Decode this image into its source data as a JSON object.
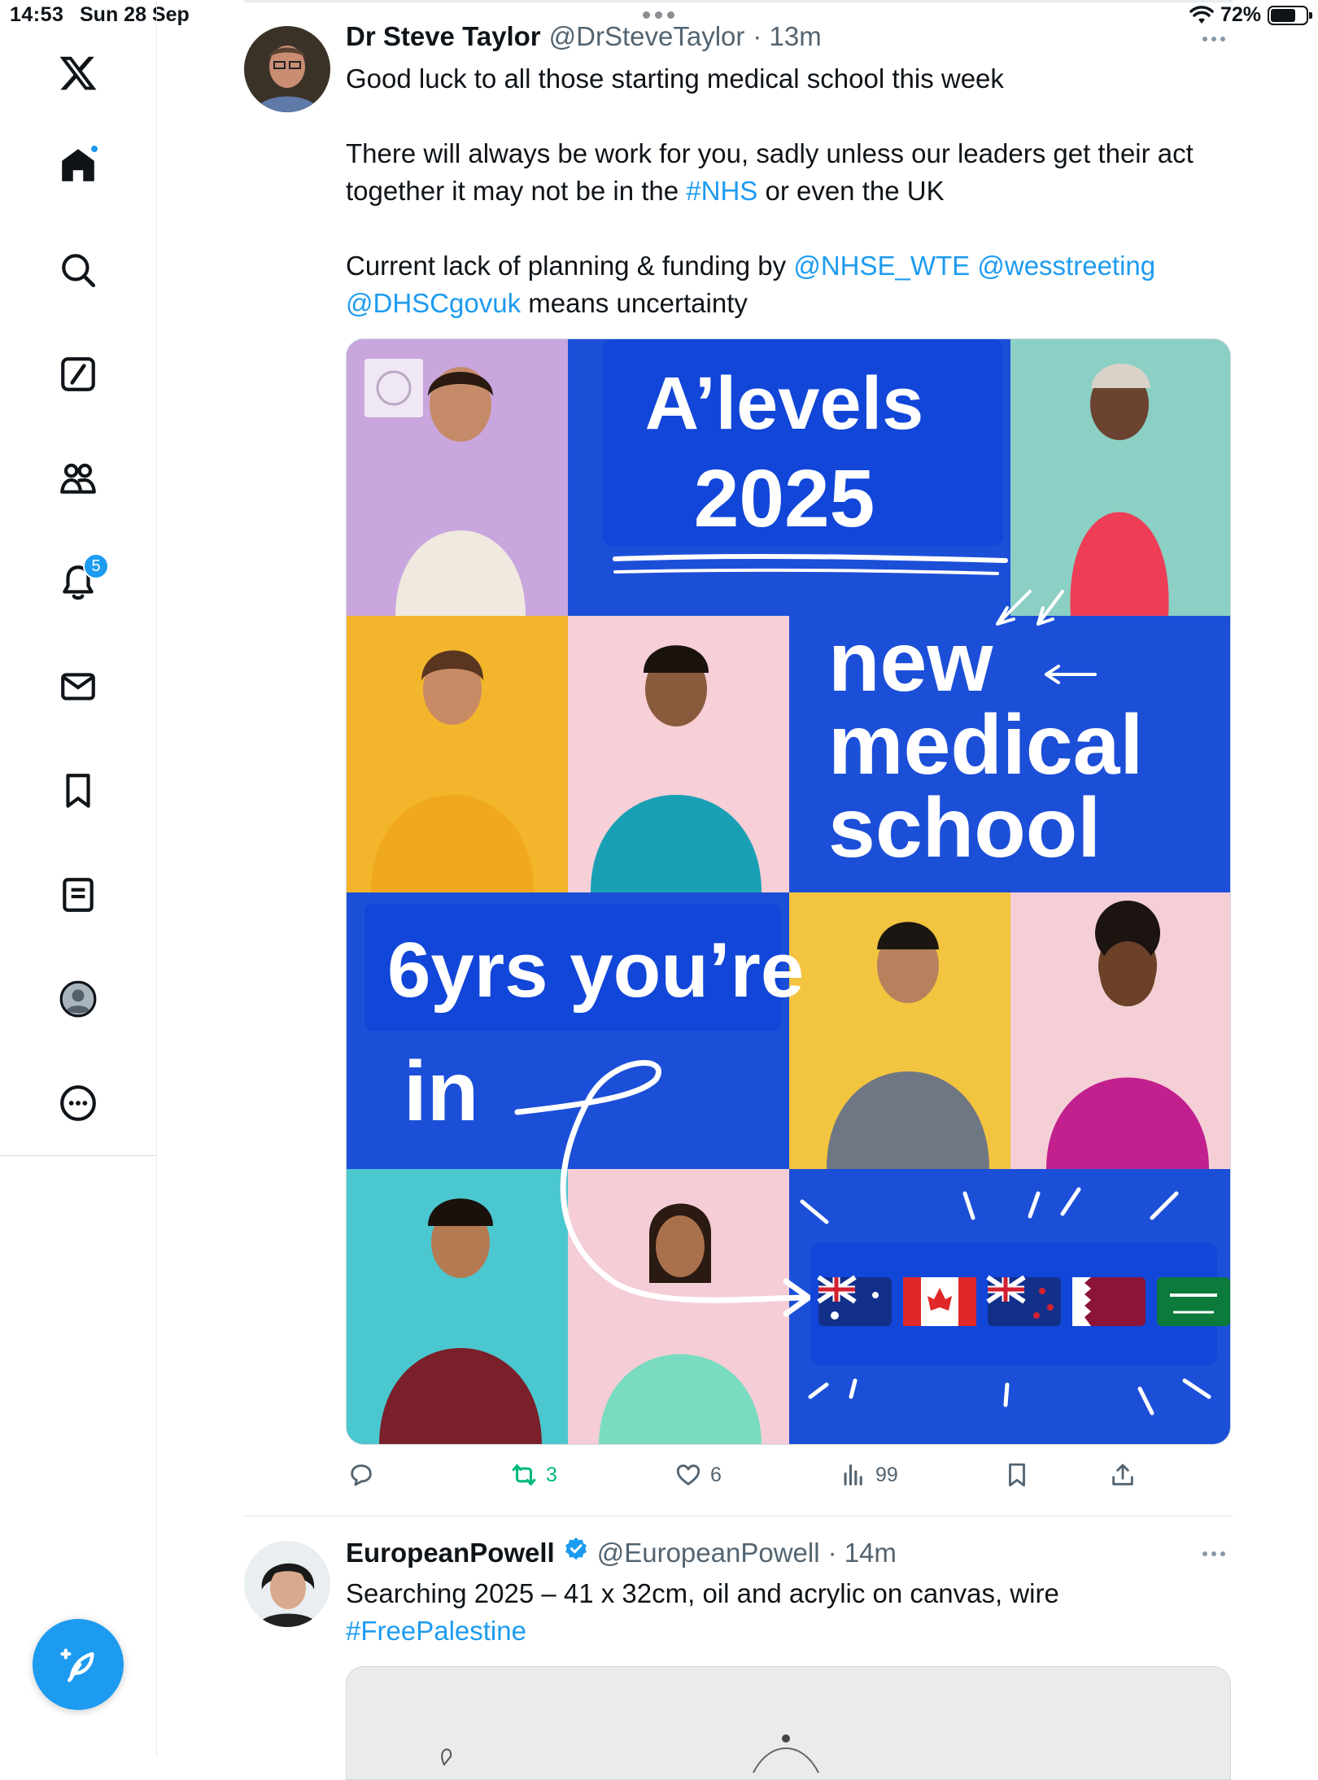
{
  "status_bar": {
    "time": "14:53",
    "date": "Sun 28 Sep",
    "battery": "72%",
    "battery_level": 0.72
  },
  "sidebar": {
    "items": [
      {
        "name": "home",
        "icon": "home-icon"
      },
      {
        "name": "explore",
        "icon": "search-icon"
      },
      {
        "name": "grok",
        "icon": "grok-icon"
      },
      {
        "name": "communities",
        "icon": "communities-icon"
      },
      {
        "name": "notifications",
        "icon": "bell-icon",
        "badge": "5"
      },
      {
        "name": "messages",
        "icon": "mail-icon"
      },
      {
        "name": "bookmarks",
        "icon": "bookmark-icon"
      },
      {
        "name": "lists",
        "icon": "list-icon"
      },
      {
        "name": "profile",
        "icon": "profile-icon"
      },
      {
        "name": "more",
        "icon": "more-circle-icon"
      }
    ]
  },
  "tweet1": {
    "author": "Dr Steve Taylor",
    "handle": "@DrSteveTaylor",
    "time": "· 13m",
    "text": {
      "line1": "Good luck to all those starting medical school this week",
      "p2_a": "There will always be work for you, sadly unless our leaders get their act together it may not be in the ",
      "p2_link": "#NHS",
      "p2_b": " or even the UK",
      "p3_a": "Current lack of planning & funding by ",
      "p3_link1": "@NHSE_WTE",
      "p3_link2": "@wesstreeting",
      "p3_link3": "@DHSCgovuk",
      "p3_b": " means uncertainty"
    },
    "image": {
      "title_line1": "A’levels",
      "title_line2": "2025",
      "new_line1": "new",
      "new_line2": "medical",
      "new_line3": "school",
      "years_line1": "6yrs you’re",
      "years_line2": "in"
    },
    "actions": {
      "reply": "",
      "retweets": "3",
      "likes": "6",
      "views": "99"
    }
  },
  "tweet2": {
    "author": "EuropeanPowell",
    "handle": "@EuropeanPowell",
    "time": "· 14m",
    "text_line1": "Searching 2025 – 41 x 32cm, oil and acrylic on canvas, wire",
    "hashtag": "#FreePalestine"
  },
  "colors": {
    "accent": "#1d9bf0",
    "retweet_green": "#00ba7c",
    "poster_blue": "#1c4fd8"
  }
}
